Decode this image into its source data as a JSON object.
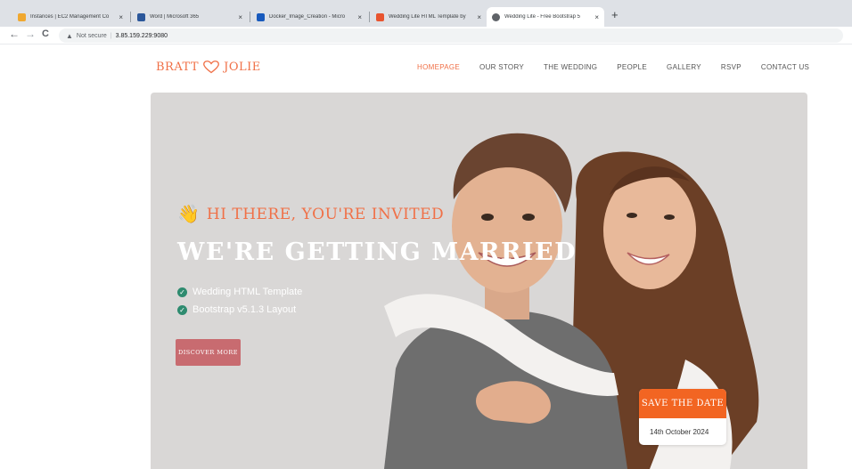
{
  "browser": {
    "tabs": [
      {
        "title": "Instances | EC2 Management Co",
        "fav_color": "#f0a830",
        "active": false
      },
      {
        "title": "Word | Microsoft 365",
        "fav_color": "#2b579a",
        "active": false
      },
      {
        "title": "Docker_Image_Creation - Micro",
        "fav_color": "#185abd",
        "active": false
      },
      {
        "title": "Wedding Lite HTML Template by",
        "fav_color": "#e8542f",
        "active": false
      },
      {
        "title": "Wedding Lite - Free Bootstrap 5",
        "fav_color": "#5f6368",
        "active": true
      }
    ],
    "new_tab": "+",
    "close_glyph": "×",
    "back": "←",
    "forward": "→",
    "reload": "C",
    "security": "Not secure",
    "url": "3.85.159.229:9080"
  },
  "site": {
    "logo_left": "BRATT",
    "logo_right": "JOLIE",
    "menu": [
      "HOMEPAGE",
      "OUR STORY",
      "THE WEDDING",
      "PEOPLE",
      "GALLERY",
      "RSVP",
      "CONTACT US"
    ],
    "active_menu": "HOMEPAGE"
  },
  "hero": {
    "wave_icon": "👋",
    "invite": "HI THERE, YOU'RE INVITED",
    "headline": "WE'RE GETTING MARRIED",
    "features": [
      "Wedding HTML Template",
      "Bootstrap v5.1.3 Layout"
    ],
    "check_glyph": "✓",
    "button": "DISCOVER MORE",
    "save_date_title": "SAVE THE DATE",
    "save_date_value": "14th October 2024"
  },
  "colors": {
    "accent": "#f07047",
    "button": "#c86b70",
    "save_date": "#f26522",
    "hero_bg": "#d9d7d6",
    "check": "#2e8b6f"
  }
}
